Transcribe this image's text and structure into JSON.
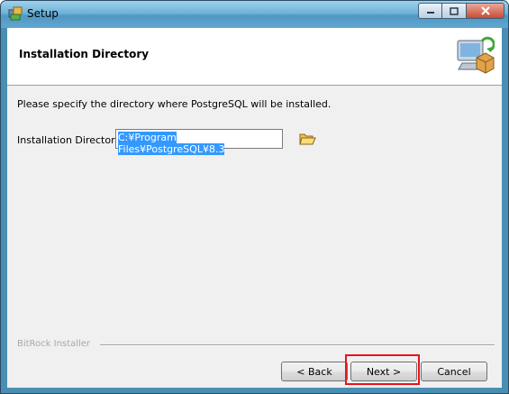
{
  "window": {
    "title": "Setup",
    "icons": {
      "app": "setup-app-icon",
      "minimize": "minimize-icon",
      "maximize": "maximize-icon",
      "close": "close-icon"
    }
  },
  "header": {
    "title": "Installation Directory",
    "image_icon": "computer-install-icon"
  },
  "body": {
    "description": "Please specify the directory where PostgreSQL will be installed.",
    "directory_label": "Installation Directory",
    "directory_value": "C:¥Program Files¥PostgreSQL¥8.3",
    "browse_icon": "open-folder-icon"
  },
  "footer": {
    "brand": "BitRock Installer",
    "back_label": "< Back",
    "next_label": "Next >",
    "cancel_label": "Cancel"
  },
  "colors": {
    "highlight_border": "#e8141b",
    "selection": "#3399ff"
  }
}
